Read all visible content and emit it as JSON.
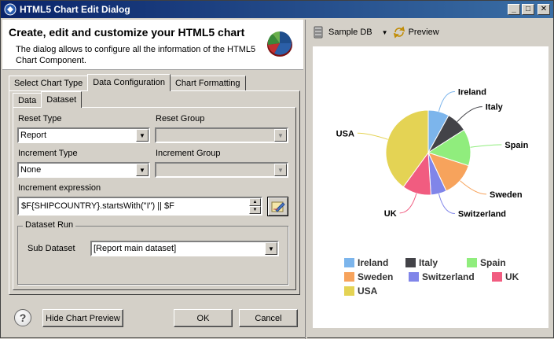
{
  "window": {
    "title": "HTML5 Chart Edit Dialog",
    "minimize_label": "_",
    "maximize_label": "□",
    "close_label": "✕"
  },
  "header": {
    "title": "Create, edit and customize your HTML5 chart",
    "description": "The dialog allows to configure all the information of the HTML5 Chart Component."
  },
  "main_tabs": [
    {
      "label": "Select Chart Type",
      "active": false
    },
    {
      "label": "Data Configuration",
      "active": true
    },
    {
      "label": "Chart Formatting",
      "active": false
    }
  ],
  "sub_tabs": [
    {
      "label": "Data",
      "active": false
    },
    {
      "label": "Dataset",
      "active": true
    }
  ],
  "form": {
    "reset_type_label": "Reset Type",
    "reset_type_value": "Report",
    "reset_group_label": "Reset Group",
    "reset_group_value": "",
    "increment_type_label": "Increment Type",
    "increment_type_value": "None",
    "increment_group_label": "Increment Group",
    "increment_group_value": "",
    "increment_expression_label": "Increment expression",
    "increment_expression_value": "$F{SHIPCOUNTRY}.startsWith(\"I\") || $F",
    "dataset_run_title": "Dataset Run",
    "sub_dataset_label": "Sub Dataset",
    "sub_dataset_value": "[Report main dataset]"
  },
  "buttons": {
    "help": "?",
    "hide_preview": "Hide Chart Preview",
    "ok": "OK",
    "cancel": "Cancel"
  },
  "preview_toolbar": {
    "sample_db_label": "Sample DB",
    "preview_label": "Preview"
  },
  "chart_data": {
    "type": "pie",
    "categories": [
      "Ireland",
      "Italy",
      "Spain",
      "Sweden",
      "Switzerland",
      "UK",
      "USA"
    ],
    "values": [
      8,
      8,
      14,
      13,
      6,
      11,
      40
    ],
    "colors": [
      "#7cb5ec",
      "#434348",
      "#90ed7d",
      "#f7a35c",
      "#8085e9",
      "#f15c80",
      "#e4d354"
    ],
    "legend_position": "bottom"
  }
}
